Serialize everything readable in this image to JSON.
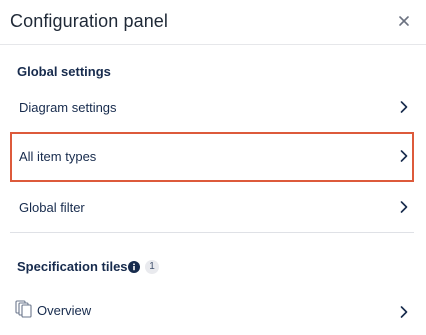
{
  "header": {
    "title": "Configuration panel",
    "close_icon": "close-icon"
  },
  "global_settings": {
    "heading": "Global settings",
    "items": [
      {
        "label": "Diagram settings",
        "icon": "chevron-right-icon",
        "highlighted": false
      },
      {
        "label": "All item types",
        "icon": "chevron-right-icon",
        "highlighted": true
      },
      {
        "label": "Global filter",
        "icon": "chevron-right-icon",
        "highlighted": false
      }
    ]
  },
  "specification_tiles": {
    "heading": "Specification tiles",
    "info_icon": "info-icon",
    "count": "1",
    "items": [
      {
        "label": "Overview",
        "icon": "overview-tile-icon",
        "chevron": "chevron-right-icon"
      }
    ]
  },
  "colors": {
    "highlight_border": "#dd5a3b",
    "text": "#172b4d",
    "divider": "#dfe1e6"
  }
}
